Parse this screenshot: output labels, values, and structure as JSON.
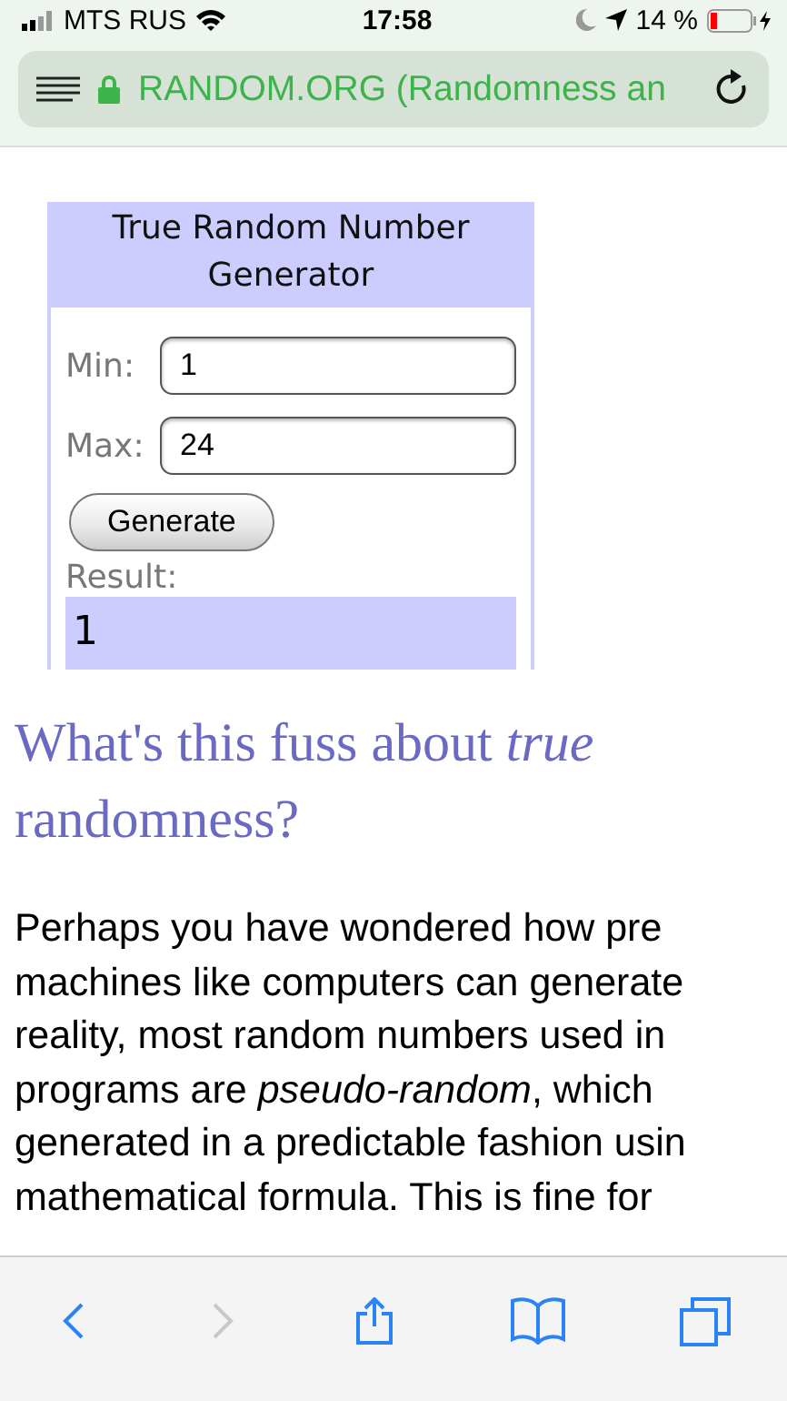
{
  "status_bar": {
    "carrier": "MTS RUS",
    "time": "17:58",
    "battery": "14 %"
  },
  "address_bar": {
    "title": "RANDOM.ORG (Randomness an"
  },
  "generator": {
    "title": "True Random Number Generator",
    "fields": [
      {
        "label": "Min:",
        "value": "1"
      },
      {
        "label": "Max:",
        "value": "24"
      }
    ],
    "button": "Generate",
    "result_label": "Result:",
    "result": "1"
  },
  "article": {
    "heading": "What's this fuss about *true* randomness?",
    "lines": [
      "Perhaps you have wondered how pre",
      "machines like computers can generate",
      "reality, most random numbers used in",
      "programs are *pseudo-random*, which",
      "generated in a predictable fashion usin",
      "mathematical formula. This is fine for"
    ]
  },
  "toolbar": {
    "items": [
      {
        "kind": "back",
        "disabled": false
      },
      {
        "kind": "forward",
        "disabled": true
      },
      {
        "kind": "share",
        "disabled": false
      },
      {
        "kind": "bookmarks",
        "disabled": false
      },
      {
        "kind": "tabs",
        "disabled": false
      }
    ]
  }
}
